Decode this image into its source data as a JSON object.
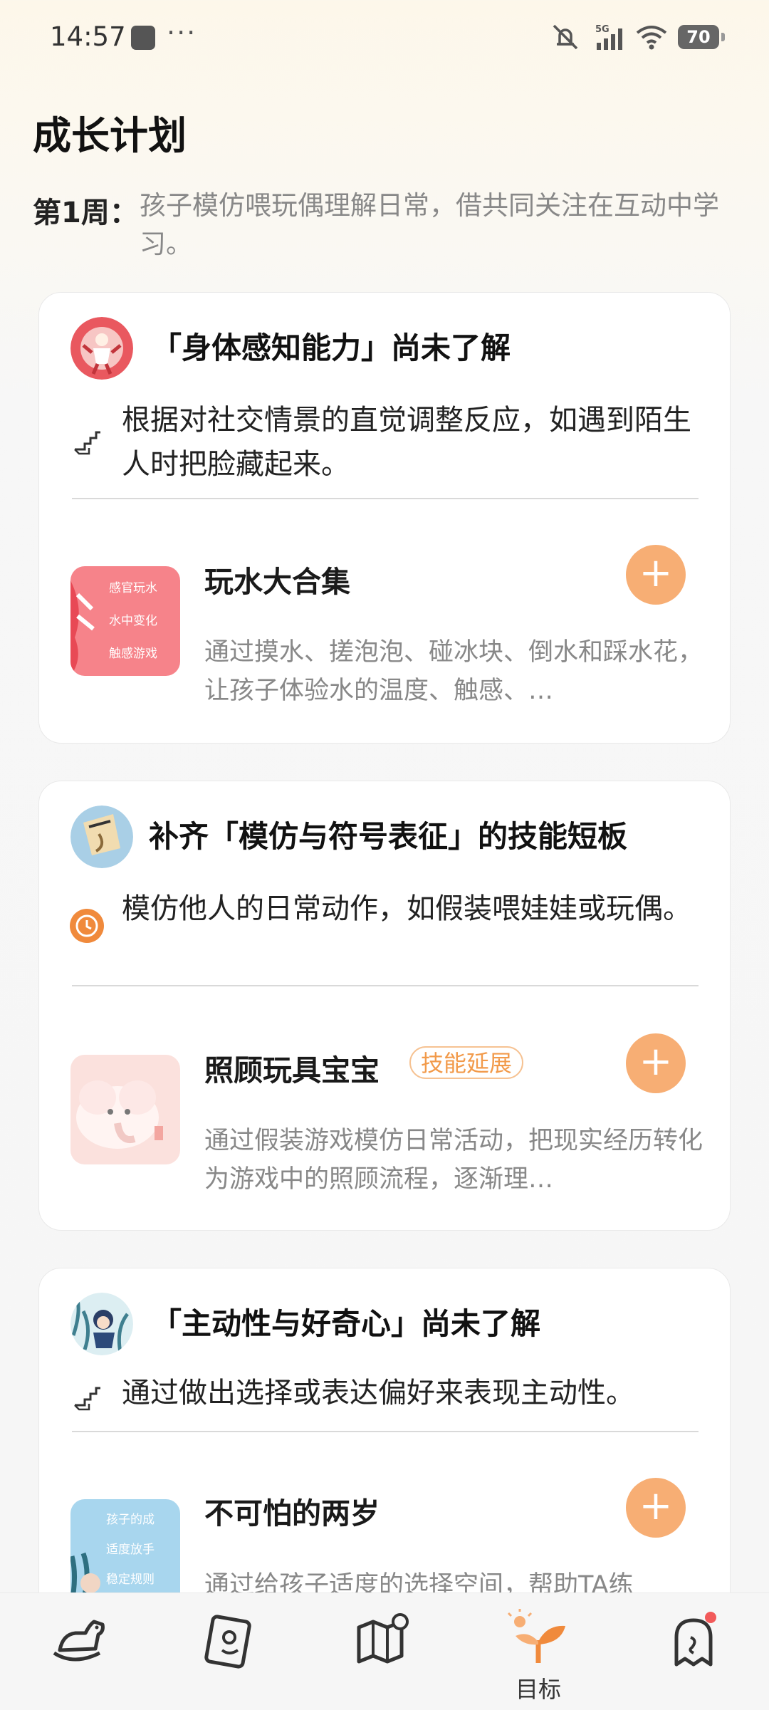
{
  "status_bar": {
    "time": "14:57",
    "dots": "···",
    "battery": "70",
    "network": "5G"
  },
  "header": {
    "title": "成长计划",
    "week_label": "第1周：",
    "week_text": "孩子模仿喂玩偶理解日常，借共同关注在互动中学习。"
  },
  "cards": [
    {
      "title": "「身体感知能力」尚未了解",
      "goal": "根据对社交情景的直觉调整反应，如遇到陌生人时把脸藏起来。",
      "goal_icon": "stairs-icon",
      "activity": {
        "title": "玩水大合集",
        "tag": "",
        "desc": "通过摸水、搓泡泡、碰冰块、倒水和踩水花，让孩子体验水的温度、触感、…",
        "thumb_text": [
          "感官玩水",
          "水中变化",
          "触感游戏"
        ],
        "add": "+"
      }
    },
    {
      "title": "补齐「模仿与符号表征」的技能短板",
      "goal": "模仿他人的日常动作，如假装喂娃娃或玩偶。",
      "goal_icon": "clock-icon",
      "activity": {
        "title": "照顾玩具宝宝",
        "tag": "技能延展",
        "desc": "通过假装游戏模仿日常活动，把现实经历转化为游戏中的照顾流程，逐渐理…",
        "thumb_text": [],
        "add": "+"
      }
    },
    {
      "title": "「主动性与好奇心」尚未了解",
      "goal": "通过做出选择或表达偏好来表现主动性。",
      "goal_icon": "stairs-icon",
      "activity": {
        "title": "不可怕的两岁",
        "tag": "",
        "desc": "通过给孩子适度的选择空间，帮助TA练",
        "thumb_text": [
          "孩子的成",
          "适度放手",
          "稳定规则"
        ],
        "add": "+"
      }
    }
  ],
  "bottom_nav": [
    {
      "icon": "rocking-horse-icon",
      "label": ""
    },
    {
      "icon": "notebook-icon",
      "label": ""
    },
    {
      "icon": "map-icon",
      "label": ""
    },
    {
      "icon": "sprout-icon",
      "label": "目标"
    },
    {
      "icon": "ghost-icon",
      "label": ""
    }
  ],
  "colors": {
    "accent": "#f7ae74",
    "tag": "#f29a4a",
    "text_muted": "#888888"
  }
}
